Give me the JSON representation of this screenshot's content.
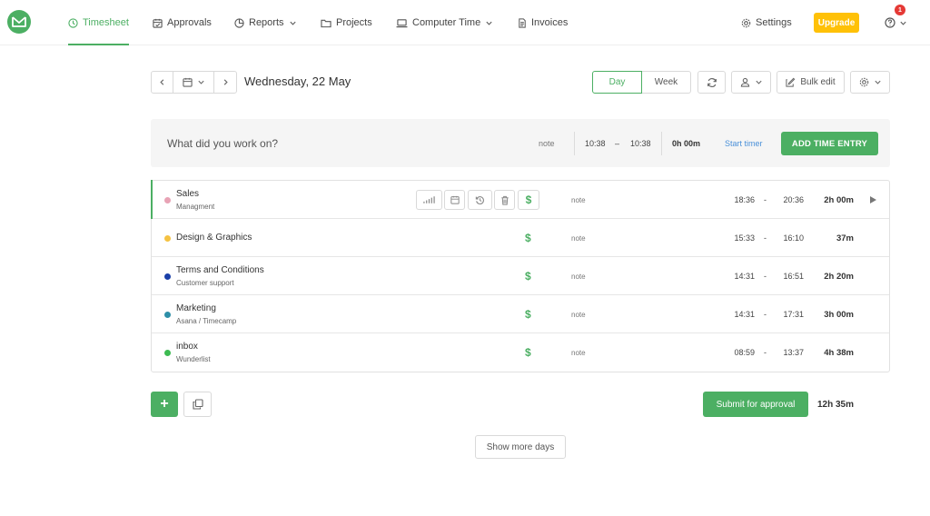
{
  "nav": {
    "items": [
      {
        "label": "Timesheet",
        "icon": "clock-icon",
        "active": true
      },
      {
        "label": "Approvals",
        "icon": "calendar-check-icon"
      },
      {
        "label": "Reports",
        "icon": "pie-chart-icon"
      },
      {
        "label": "Projects",
        "icon": "folder-icon"
      },
      {
        "label": "Computer Time",
        "icon": "laptop-icon"
      },
      {
        "label": "Invoices",
        "icon": "document-icon"
      }
    ],
    "settings_label": "Settings",
    "upgrade_label": "Upgrade",
    "notification_count": "1",
    "accent_color": "#4caf63",
    "upgrade_color": "#ffc107"
  },
  "datebar": {
    "date_label": "Wednesday, 22 May",
    "view_day": "Day",
    "view_week": "Week",
    "bulk_edit_label": "Bulk edit"
  },
  "entry": {
    "placeholder": "What did you work on?",
    "note": "note",
    "start": "10:38",
    "dash": "–",
    "end": "10:38",
    "duration": "0h 00m",
    "start_timer": "Start timer",
    "add_label": "ADD TIME ENTRY"
  },
  "entries": [
    {
      "project": "Sales",
      "task": "Managment",
      "dot": "#e8a3b5",
      "billable": "$",
      "note": "note",
      "start": "18:36",
      "dash": "-",
      "end": "20:36",
      "duration": "2h 00m"
    },
    {
      "project": "Design & Graphics",
      "task": "",
      "dot": "#f5c242",
      "billable": "$",
      "note": "note",
      "start": "15:33",
      "dash": "-",
      "end": "16:10",
      "duration": "37m"
    },
    {
      "project": "Terms and Conditions",
      "task": "Customer support",
      "dot": "#1a3fa8",
      "billable": "$",
      "note": "note",
      "start": "14:31",
      "dash": "-",
      "end": "16:51",
      "duration": "2h 20m"
    },
    {
      "project": "Marketing",
      "task": "Asana / Timecamp",
      "dot": "#2e8fa8",
      "billable": "$",
      "note": "note",
      "start": "14:31",
      "dash": "-",
      "end": "17:31",
      "duration": "3h 00m"
    },
    {
      "project": "inbox",
      "task": "Wunderlist",
      "dot": "#3dbb52",
      "billable": "$",
      "note": "note",
      "start": "08:59",
      "dash": "-",
      "end": "13:37",
      "duration": "4h 38m"
    }
  ],
  "footer": {
    "add_symbol": "+",
    "submit_label": "Submit for approval",
    "total": "12h 35m",
    "show_more": "Show more days"
  }
}
